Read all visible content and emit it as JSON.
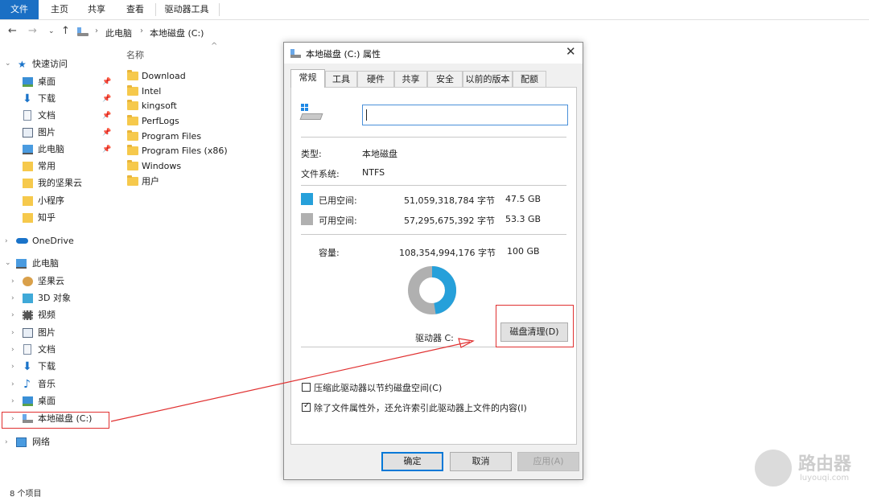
{
  "ribbon": {
    "tabs": [
      "文件",
      "主页",
      "共享",
      "查看",
      "驱动器工具"
    ]
  },
  "address": {
    "crumbs": [
      "此电脑",
      "本地磁盘 (C:)"
    ]
  },
  "nav": {
    "quick_access": "快速访问",
    "quick_items": [
      "桌面",
      "下载",
      "文档",
      "图片",
      "此电脑",
      "常用",
      "我的坚果云",
      "小程序",
      "知乎"
    ],
    "onedrive": "OneDrive",
    "this_pc": "此电脑",
    "pc_items": [
      "坚果云",
      "3D 对象",
      "视频",
      "图片",
      "文档",
      "下载",
      "音乐",
      "桌面",
      "本地磁盘 (C:)"
    ],
    "network": "网络"
  },
  "files": {
    "column_name": "名称",
    "items": [
      "Download",
      "Intel",
      "kingsoft",
      "PerfLogs",
      "Program Files",
      "Program Files (x86)",
      "Windows",
      "用户"
    ]
  },
  "status": {
    "count": "8 个项目"
  },
  "dialog": {
    "title": "本地磁盘 (C:) 属性",
    "tabs": [
      "常规",
      "工具",
      "硬件",
      "共享",
      "安全",
      "以前的版本",
      "配额"
    ],
    "name_value": "",
    "type_label": "类型:",
    "type_value": "本地磁盘",
    "fs_label": "文件系统:",
    "fs_value": "NTFS",
    "used": {
      "label": "已用空间:",
      "bytes": "51,059,318,784 字节",
      "size": "47.5 GB",
      "color": "#26a0da"
    },
    "free": {
      "label": "可用空间:",
      "bytes": "57,295,675,392 字节",
      "size": "53.3 GB",
      "color": "#b0b0b0"
    },
    "capacity": {
      "label": "容量:",
      "bytes": "108,354,994,176 字节",
      "size": "100 GB"
    },
    "used_fraction": 0.475,
    "drive_label": "驱动器 C:",
    "cleanup_button": "磁盘清理(D)",
    "compress_label": "压缩此驱动器以节约磁盘空间(C)",
    "compress_checked": false,
    "index_label": "除了文件属性外，还允许索引此驱动器上文件的内容(I)",
    "index_checked": true,
    "ok": "确定",
    "cancel": "取消",
    "apply": "应用(A)"
  },
  "watermark": {
    "brand": "路由器",
    "site": "luyouqi.com"
  }
}
